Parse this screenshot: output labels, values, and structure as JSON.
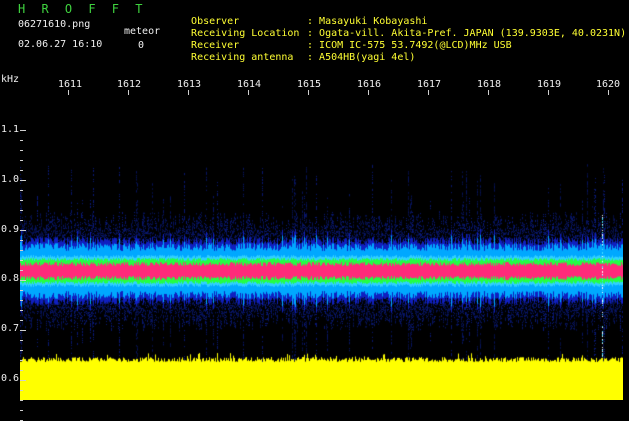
{
  "header": {
    "app_name": "H R O F F T",
    "filename": "06271610.png",
    "datetime": "02.06.27 16:10",
    "meteor_label": "meteor",
    "meteor_count": "0"
  },
  "station": [
    {
      "key": "Observer",
      "value": "Masayuki Kobayashi"
    },
    {
      "key": "Receiving Location",
      "value": "Ogata-vill. Akita-Pref. JAPAN (139.9303E, 40.0231N)"
    },
    {
      "key": "Receiver",
      "value": "ICOM IC-575 53.7492(@LCD)MHz USB"
    },
    {
      "key": "Receiving antenna",
      "value": "A504HB(yagi 4el)"
    }
  ],
  "axes": {
    "y_unit": "kHz",
    "y_ticks": [
      "1.1",
      "1.0",
      "0.9",
      "0.8",
      "0.7",
      "0.6"
    ],
    "x_ticks": [
      "1611",
      "1612",
      "1613",
      "1614",
      "1615",
      "1616",
      "1617",
      "1618",
      "1619",
      "1620"
    ]
  },
  "colors": {
    "band_core": "#ff2a7a",
    "band_mid": "#22ff44",
    "band_outer": "#00a8ff",
    "band_halo": "#1020c0",
    "noise_floor": "#ffff00",
    "green_text": "#3fd23f",
    "yellow_text": "#ffff33"
  }
}
